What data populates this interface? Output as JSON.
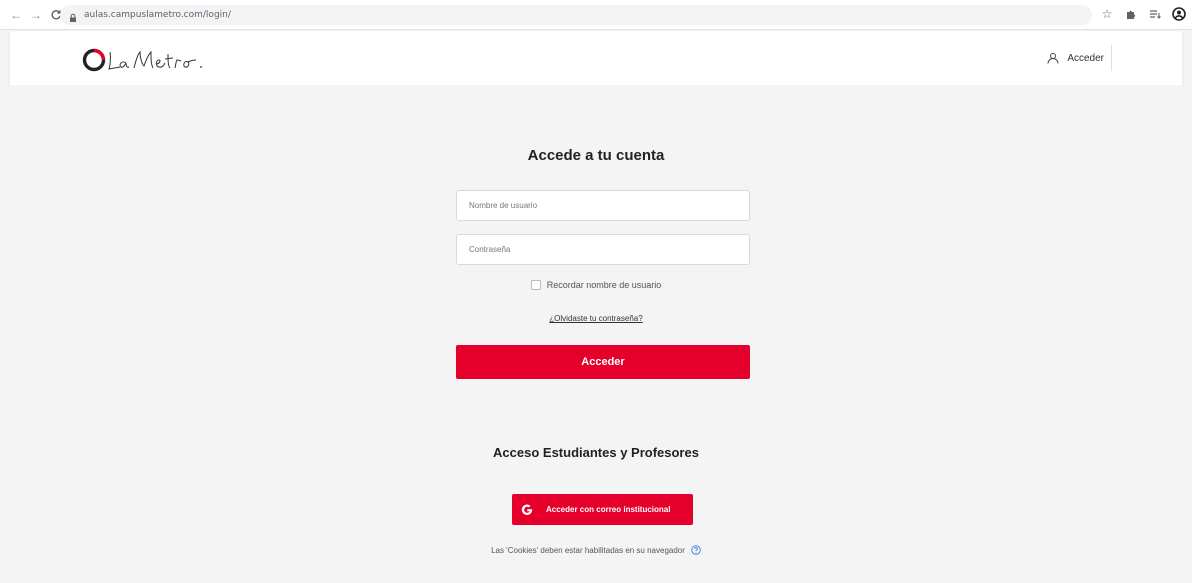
{
  "browser": {
    "url": "aulas.campuslametro.com/login/",
    "icons": [
      "back-arrow-icon",
      "forward-arrow-icon",
      "reload-icon",
      "lock-icon",
      "star-icon",
      "extensions-icon",
      "reading-list-icon",
      "profile-icon"
    ]
  },
  "header": {
    "logo_text": "La Metro",
    "login_label": "Acceder"
  },
  "login": {
    "title": "Accede a tu cuenta",
    "username_placeholder": "Nombre de usuario",
    "password_placeholder": "Contraseña",
    "remember_label": "Recordar nombre de usuario",
    "forgot_link": "¿Olvidaste tu contraseña?",
    "submit_label": "Acceder"
  },
  "students": {
    "title": "Acceso Estudiantes y Profesores",
    "google_button_label": "Acceder con correo institucional"
  },
  "footer": {
    "cookies_text": "Las 'Cookies' deben estar habilitadas en su navegador"
  },
  "colors": {
    "accent": "#e4002b",
    "background": "#f4f4f4",
    "header_bg": "#ffffff"
  }
}
